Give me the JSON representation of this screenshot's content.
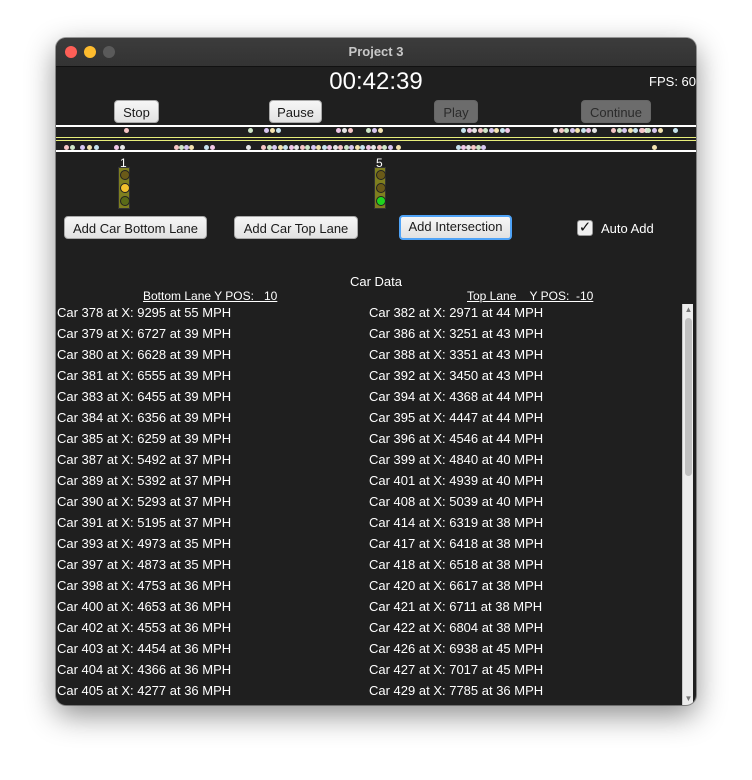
{
  "window": {
    "title": "Project 3"
  },
  "clock": "00:42:39",
  "fps": "FPS: 60",
  "controls": {
    "stop": "Stop",
    "pause": "Pause",
    "play": "Play",
    "continue": "Continue"
  },
  "actions": {
    "add_bottom": "Add Car Bottom Lane",
    "add_top": "Add Car Top Lane",
    "add_intersection": "Add Intersection"
  },
  "auto_add": {
    "label": "Auto Add",
    "checked": true,
    "check_glyph": "✓"
  },
  "intersections": [
    {
      "label": "1",
      "state": "yellow"
    },
    {
      "label": "5",
      "state": "green"
    }
  ],
  "colors": {
    "road_line": "#ffffff",
    "lane_divider": "#e8ee7a",
    "light_housing": "#7f7f1f",
    "lamp_red": "#5a4a12",
    "lamp_yellow": "#f2c12e",
    "lamp_green": "#1fd31f",
    "lamp_off": "#6a5a18"
  },
  "car_data": {
    "title": "Car Data",
    "bottom_header": "Bottom Lane Y POS:   10",
    "top_header": "Top Lane    Y POS:  -10",
    "bottom": [
      "Car 378 at X: 9295 at 55 MPH",
      "Car 379 at X: 6727 at 39 MPH",
      "Car 380 at X: 6628 at 39 MPH",
      "Car 381 at X: 6555 at 39 MPH",
      "Car 383 at X: 6455 at 39 MPH",
      "Car 384 at X: 6356 at 39 MPH",
      "Car 385 at X: 6259 at 39 MPH",
      "Car 387 at X: 5492 at 37 MPH",
      "Car 389 at X: 5392 at 37 MPH",
      "Car 390 at X: 5293 at 37 MPH",
      "Car 391 at X: 5195 at 37 MPH",
      "Car 393 at X: 4973 at 35 MPH",
      "Car 397 at X: 4873 at 35 MPH",
      "Car 398 at X: 4753 at 36 MPH",
      "Car 400 at X: 4653 at 36 MPH",
      "Car 402 at X: 4553 at 36 MPH",
      "Car 403 at X: 4454 at 36 MPH",
      "Car 404 at X: 4366 at 36 MPH",
      "Car 405 at X: 4277 at 36 MPH"
    ],
    "top": [
      "Car 382 at X: 2971 at 44 MPH",
      "Car 386 at X: 3251 at 43 MPH",
      "Car 388 at X: 3351 at 43 MPH",
      "Car 392 at X: 3450 at 43 MPH",
      "Car 394 at X: 4368 at 44 MPH",
      "Car 395 at X: 4447 at 44 MPH",
      "Car 396 at X: 4546 at 44 MPH",
      "Car 399 at X: 4840 at 40 MPH",
      "Car 401 at X: 4939 at 40 MPH",
      "Car 408 at X: 5039 at 40 MPH",
      "Car 414 at X: 6319 at 38 MPH",
      "Car 417 at X: 6418 at 38 MPH",
      "Car 418 at X: 6518 at 38 MPH",
      "Car 420 at X: 6617 at 38 MPH",
      "Car 421 at X: 6711 at 38 MPH",
      "Car 422 at X: 6804 at 38 MPH",
      "Car 426 at X: 6938 at 45 MPH",
      "Car 427 at X: 7017 at 45 MPH",
      "Car 429 at X: 7785 at 36 MPH"
    ]
  }
}
